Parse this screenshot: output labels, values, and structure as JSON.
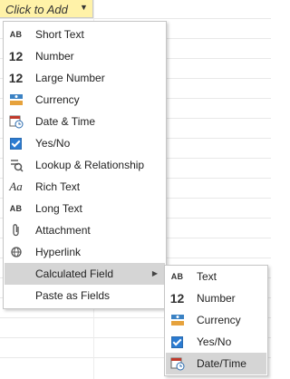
{
  "header": {
    "label": "Click to Add"
  },
  "menu": {
    "items": [
      {
        "label": "Short Text",
        "icon": "short-text-icon",
        "glyph": "AB"
      },
      {
        "label": "Number",
        "icon": "number-icon",
        "glyph": "12"
      },
      {
        "label": "Large Number",
        "icon": "large-number-icon",
        "glyph": "12"
      },
      {
        "label": "Currency",
        "icon": "currency-icon"
      },
      {
        "label": "Date & Time",
        "icon": "calendar-clock-icon"
      },
      {
        "label": "Yes/No",
        "icon": "checkbox-icon"
      },
      {
        "label": "Lookup & Relationship",
        "icon": "lookup-icon"
      },
      {
        "label": "Rich Text",
        "icon": "rich-text-icon",
        "glyph": "Aa"
      },
      {
        "label": "Long Text",
        "icon": "long-text-icon",
        "glyph": "AB"
      },
      {
        "label": "Attachment",
        "icon": "paperclip-icon"
      },
      {
        "label": "Hyperlink",
        "icon": "link-icon"
      },
      {
        "label": "Calculated Field",
        "icon": "none",
        "active": true
      },
      {
        "label": "Paste as Fields",
        "icon": "none"
      }
    ]
  },
  "submenu": {
    "items": [
      {
        "label": "Text",
        "icon": "text-icon",
        "glyph": "AB"
      },
      {
        "label": "Number",
        "icon": "number-icon",
        "glyph": "12"
      },
      {
        "label": "Currency",
        "icon": "currency-icon"
      },
      {
        "label": "Yes/No",
        "icon": "checkbox-icon"
      },
      {
        "label": "Date/Time",
        "icon": "calendar-clock-icon",
        "active": true
      }
    ]
  },
  "colors": {
    "header_bg": "#fff2a8",
    "active_bg": "#d5d5d5",
    "accent_blue": "#2b7bd1"
  }
}
